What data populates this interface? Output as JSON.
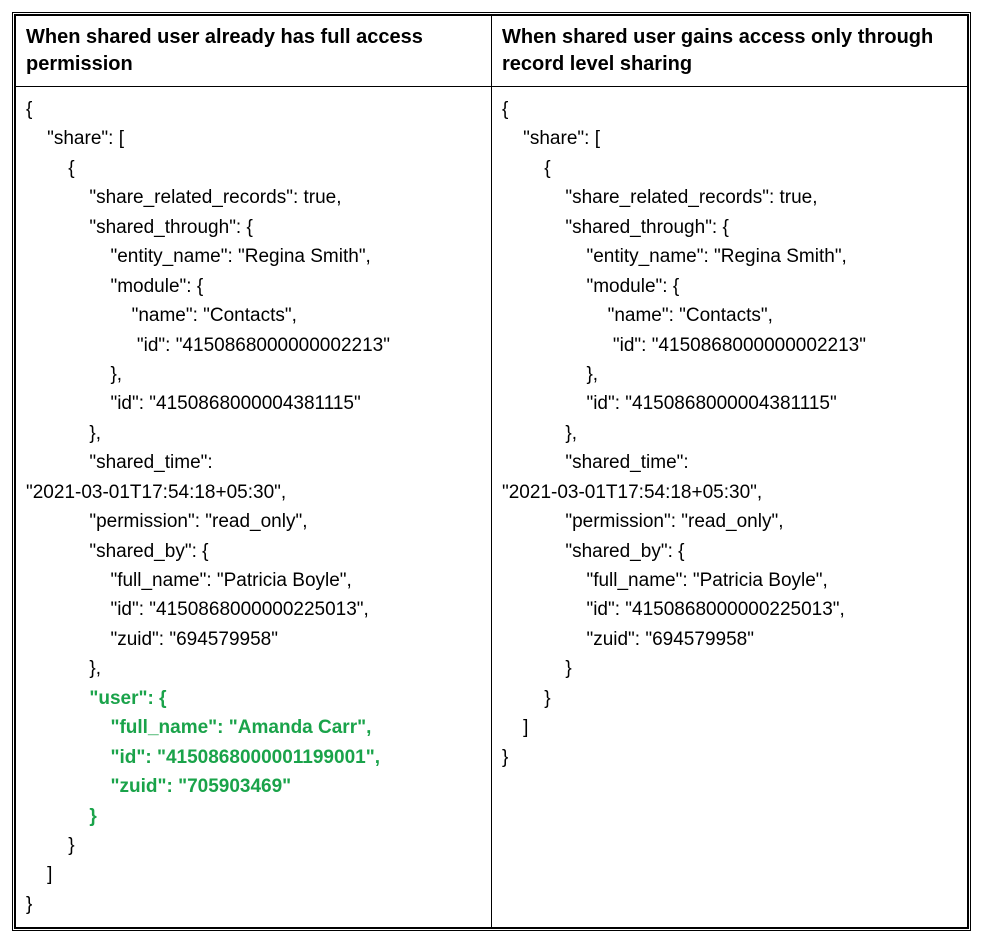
{
  "headers": {
    "left": "When shared user already has full access permission",
    "right": "When shared user gains access only through record level sharing"
  },
  "left": {
    "l01": "{",
    "l02": "    \"share\": [",
    "l03": "        {",
    "l04": "            \"share_related_records\": true,",
    "l05": "            \"shared_through\": {",
    "l06": "                \"entity_name\": \"Regina Smith\",",
    "l07": "                \"module\": {",
    "l08": "                    \"name\": \"Contacts\",",
    "l09": "                     \"id\": \"4150868000000002213\"",
    "l10": "                },",
    "l11": "                \"id\": \"4150868000004381115\"",
    "l12": "            },",
    "l13": "            \"shared_time\":",
    "l14": "\"2021-03-01T17:54:18+05:30\",",
    "l15": "            \"permission\": \"read_only\",",
    "l16": "            \"shared_by\": {",
    "l17": "                \"full_name\": \"Patricia Boyle\",",
    "l18": "                \"id\": \"4150868000000225013\",",
    "l19": "                \"zuid\": \"694579958\"",
    "l20": "            },",
    "h01": "            \"user\": {",
    "h02": "                \"full_name\": \"Amanda Carr\",",
    "h03": "                \"id\": \"4150868000001199001\",",
    "h04": "                \"zuid\": \"705903469\"",
    "h05": "            }",
    "l26": "        }",
    "l27": "    ]",
    "l28": "}"
  },
  "right": {
    "l01": "{",
    "l02": "    \"share\": [",
    "l03": "        {",
    "l04": "            \"share_related_records\": true,",
    "l05": "            \"shared_through\": {",
    "l06": "                \"entity_name\": \"Regina Smith\",",
    "l07": "                \"module\": {",
    "l08": "                    \"name\": \"Contacts\",",
    "l09": "                     \"id\": \"4150868000000002213\"",
    "l10": "                },",
    "l11": "                \"id\": \"4150868000004381115\"",
    "l12": "            },",
    "l13": "            \"shared_time\":",
    "l14": "\"2021-03-01T17:54:18+05:30\",",
    "l15": "            \"permission\": \"read_only\",",
    "l16": "            \"shared_by\": {",
    "l17": "                \"full_name\": \"Patricia Boyle\",",
    "l18": "                \"id\": \"4150868000000225013\",",
    "l19": "                \"zuid\": \"694579958\"",
    "l20": "            }",
    "l21": "        }",
    "l22": "    ]",
    "l23": "}"
  }
}
